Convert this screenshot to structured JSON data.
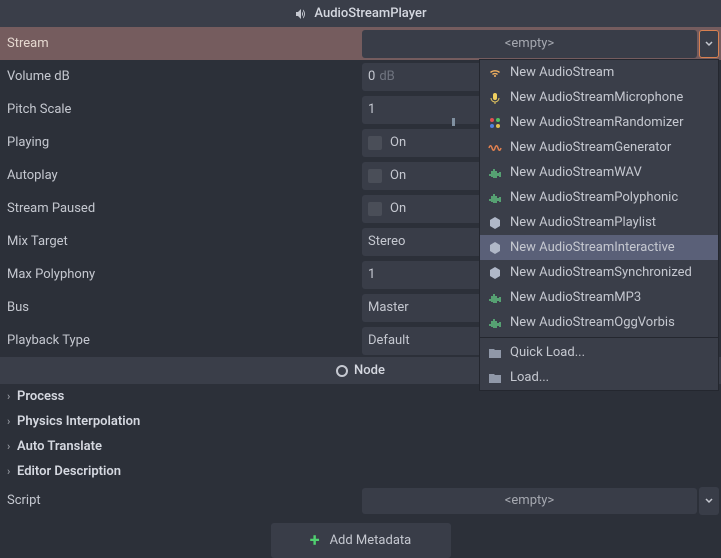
{
  "header": {
    "title": "AudioStreamPlayer"
  },
  "properties": {
    "stream": {
      "label": "Stream",
      "value": "<empty>"
    },
    "volume_db": {
      "label": "Volume dB",
      "value": "0",
      "unit": "dB"
    },
    "pitch_scale": {
      "label": "Pitch Scale",
      "value": "1"
    },
    "playing": {
      "label": "Playing",
      "value": "On"
    },
    "autoplay": {
      "label": "Autoplay",
      "value": "On"
    },
    "stream_paused": {
      "label": "Stream Paused",
      "value": "On"
    },
    "mix_target": {
      "label": "Mix Target",
      "value": "Stereo"
    },
    "max_polyphony": {
      "label": "Max Polyphony",
      "value": "1"
    },
    "bus": {
      "label": "Bus",
      "value": "Master"
    },
    "playback_type": {
      "label": "Playback Type",
      "value": "Default"
    }
  },
  "node_section": {
    "title": "Node"
  },
  "expandables": {
    "process": "Process",
    "physics_interpolation": "Physics Interpolation",
    "auto_translate": "Auto Translate",
    "editor_description": "Editor Description"
  },
  "script": {
    "label": "Script",
    "value": "<empty>"
  },
  "add_metadata": "Add Metadata",
  "dropdown": {
    "items": [
      {
        "label": "New AudioStream",
        "icon": "wifi"
      },
      {
        "label": "New AudioStreamMicrophone",
        "icon": "mic"
      },
      {
        "label": "New AudioStreamRandomizer",
        "icon": "random"
      },
      {
        "label": "New AudioStreamGenerator",
        "icon": "wave"
      },
      {
        "label": "New AudioStreamWAV",
        "icon": "audio"
      },
      {
        "label": "New AudioStreamPolyphonic",
        "icon": "audio"
      },
      {
        "label": "New AudioStreamPlaylist",
        "icon": "box"
      },
      {
        "label": "New AudioStreamInteractive",
        "icon": "box",
        "selected": true
      },
      {
        "label": "New AudioStreamSynchronized",
        "icon": "box"
      },
      {
        "label": "New AudioStreamMP3",
        "icon": "audio"
      },
      {
        "label": "New AudioStreamOggVorbis",
        "icon": "audio"
      }
    ],
    "quick_load": "Quick Load...",
    "load": "Load..."
  }
}
